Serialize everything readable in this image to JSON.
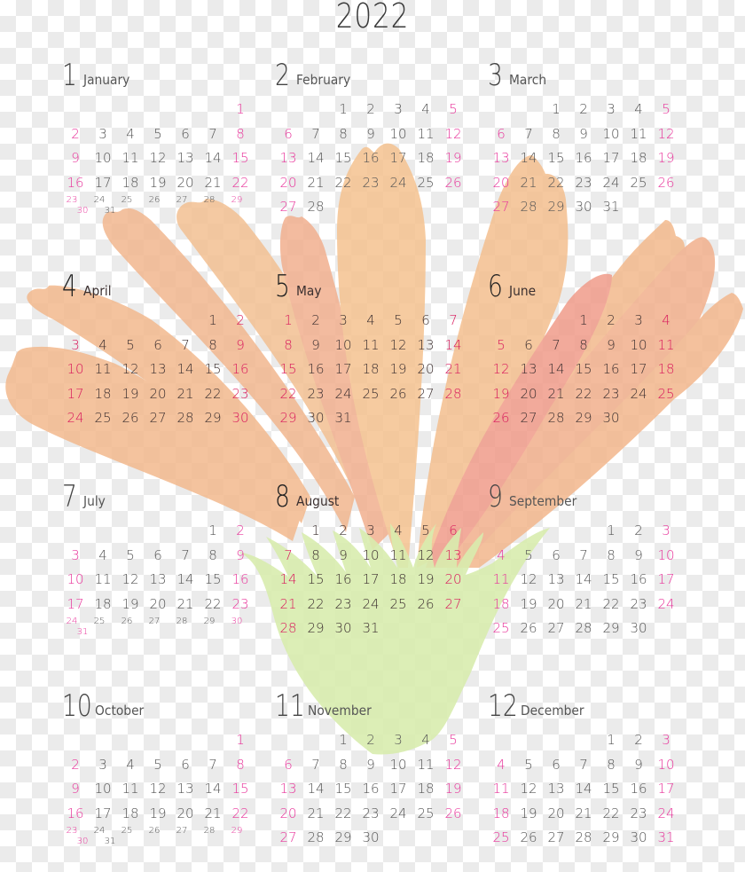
{
  "year": "2022",
  "colors": {
    "weekend": "#e8359b",
    "weekday": "#555555",
    "petal_orange": "#f5c08a",
    "petal_pink": "#f4a68e",
    "petal_red": "#f29a8c",
    "sepal_green": "#d6ecaa",
    "checker_light": "#ffffff",
    "checker_dark": "#ebebeb"
  },
  "week_start": "Sunday",
  "months": [
    {
      "num": "1",
      "name": "January",
      "first_weekday": 6,
      "days": 31
    },
    {
      "num": "2",
      "name": "February",
      "first_weekday": 2,
      "days": 28
    },
    {
      "num": "3",
      "name": "March",
      "first_weekday": 2,
      "days": 31
    },
    {
      "num": "4",
      "name": "April",
      "first_weekday": 5,
      "days": 30
    },
    {
      "num": "5",
      "name": "May",
      "first_weekday": 0,
      "days": 31
    },
    {
      "num": "6",
      "name": "June",
      "first_weekday": 3,
      "days": 30
    },
    {
      "num": "7",
      "name": "July",
      "first_weekday": 5,
      "days": 31
    },
    {
      "num": "8",
      "name": "August",
      "first_weekday": 1,
      "days": 31
    },
    {
      "num": "9",
      "name": "September",
      "first_weekday": 4,
      "days": 30
    },
    {
      "num": "10",
      "name": "October",
      "first_weekday": 6,
      "days": 31
    },
    {
      "num": "11",
      "name": "November",
      "first_weekday": 2,
      "days": 30
    },
    {
      "num": "12",
      "name": "December",
      "first_weekday": 4,
      "days": 31
    }
  ],
  "illustration": "flower-icon"
}
